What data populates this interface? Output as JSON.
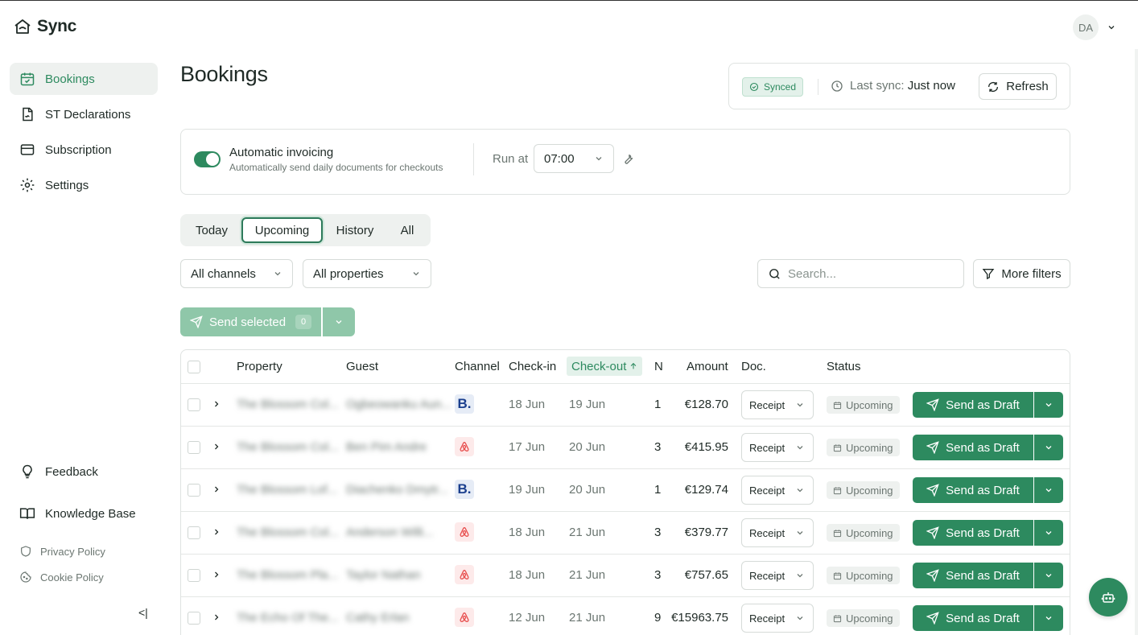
{
  "app": {
    "name": "Sync"
  },
  "sidebar": {
    "items": [
      {
        "label": "Bookings",
        "icon": "calendar-check-icon",
        "active": true
      },
      {
        "label": "ST Declarations",
        "icon": "file-sign-icon",
        "active": false
      },
      {
        "label": "Subscription",
        "icon": "credit-card-icon",
        "active": false
      },
      {
        "label": "Settings",
        "icon": "gear-icon",
        "active": false
      }
    ],
    "bottom": [
      {
        "label": "Feedback",
        "icon": "lightbulb-icon"
      },
      {
        "label": "Knowledge Base",
        "icon": "book-icon"
      }
    ],
    "legal": [
      {
        "label": "Privacy Policy",
        "icon": "shield-icon"
      },
      {
        "label": "Cookie Policy",
        "icon": "cookie-icon"
      }
    ],
    "collapse_label": "<|"
  },
  "header": {
    "title": "Bookings",
    "user_initials": "DA"
  },
  "sync": {
    "status": "Synced",
    "last_sync_label": "Last sync:",
    "last_sync_value": "Just now",
    "refresh_label": "Refresh"
  },
  "invoicing": {
    "enabled": true,
    "title": "Automatic invoicing",
    "subtitle": "Automatically send daily documents for checkouts",
    "run_at_label": "Run at",
    "run_at_value": "07:00"
  },
  "tabs": [
    {
      "label": "Today",
      "active": false
    },
    {
      "label": "Upcoming",
      "active": true
    },
    {
      "label": "History",
      "active": false
    },
    {
      "label": "All",
      "active": false
    }
  ],
  "filters": {
    "channels": "All channels",
    "properties": "All properties",
    "search_placeholder": "Search...",
    "more_filters": "More filters"
  },
  "bulk": {
    "send_selected_label": "Send selected",
    "selected_count": "0"
  },
  "table": {
    "columns": {
      "property": "Property",
      "guest": "Guest",
      "channel": "Channel",
      "checkin": "Check-in",
      "checkout": "Check-out",
      "nights": "N",
      "amount": "Amount",
      "doc": "Doc.",
      "status": "Status"
    },
    "sorted_by": "checkout",
    "action_label": "Send as Draft",
    "rows": [
      {
        "property": "The Blossom Col...",
        "guest": "Ogbeowanku Aun...",
        "channel": "booking",
        "channel_mark": "B.",
        "checkin": "18 Jun",
        "checkout": "19 Jun",
        "nights": "1",
        "amount": "€128.70",
        "doc": "Receipt",
        "status": "Upcoming"
      },
      {
        "property": "The Blossom Col...",
        "guest": "Ben Pim Andre",
        "channel": "airbnb",
        "channel_mark": "",
        "checkin": "17 Jun",
        "checkout": "20 Jun",
        "nights": "3",
        "amount": "€415.95",
        "doc": "Receipt",
        "status": "Upcoming"
      },
      {
        "property": "The Blossom Lof...",
        "guest": "Diachenko Dmytr...",
        "channel": "booking",
        "channel_mark": "B.",
        "checkin": "19 Jun",
        "checkout": "20 Jun",
        "nights": "1",
        "amount": "€129.74",
        "doc": "Receipt",
        "status": "Upcoming"
      },
      {
        "property": "The Blossom Col...",
        "guest": "Anderson Willi...",
        "channel": "airbnb",
        "channel_mark": "",
        "checkin": "18 Jun",
        "checkout": "21 Jun",
        "nights": "3",
        "amount": "€379.77",
        "doc": "Receipt",
        "status": "Upcoming"
      },
      {
        "property": "The Blossom Pla...",
        "guest": "Taylor Nathan",
        "channel": "airbnb",
        "channel_mark": "",
        "checkin": "18 Jun",
        "checkout": "21 Jun",
        "nights": "3",
        "amount": "€757.65",
        "doc": "Receipt",
        "status": "Upcoming"
      },
      {
        "property": "The Echo Of The...",
        "guest": "Cathy Erlan",
        "channel": "airbnb",
        "channel_mark": "",
        "checkin": "12 Jun",
        "checkout": "21 Jun",
        "nights": "9",
        "amount": "€15963.75",
        "doc": "Receipt",
        "status": "Upcoming"
      }
    ]
  },
  "colors": {
    "brand": "#2d8a5f",
    "brand_light": "#8fc7a9",
    "airbnb": "#e8504f",
    "booking": "#1b3f8e"
  }
}
